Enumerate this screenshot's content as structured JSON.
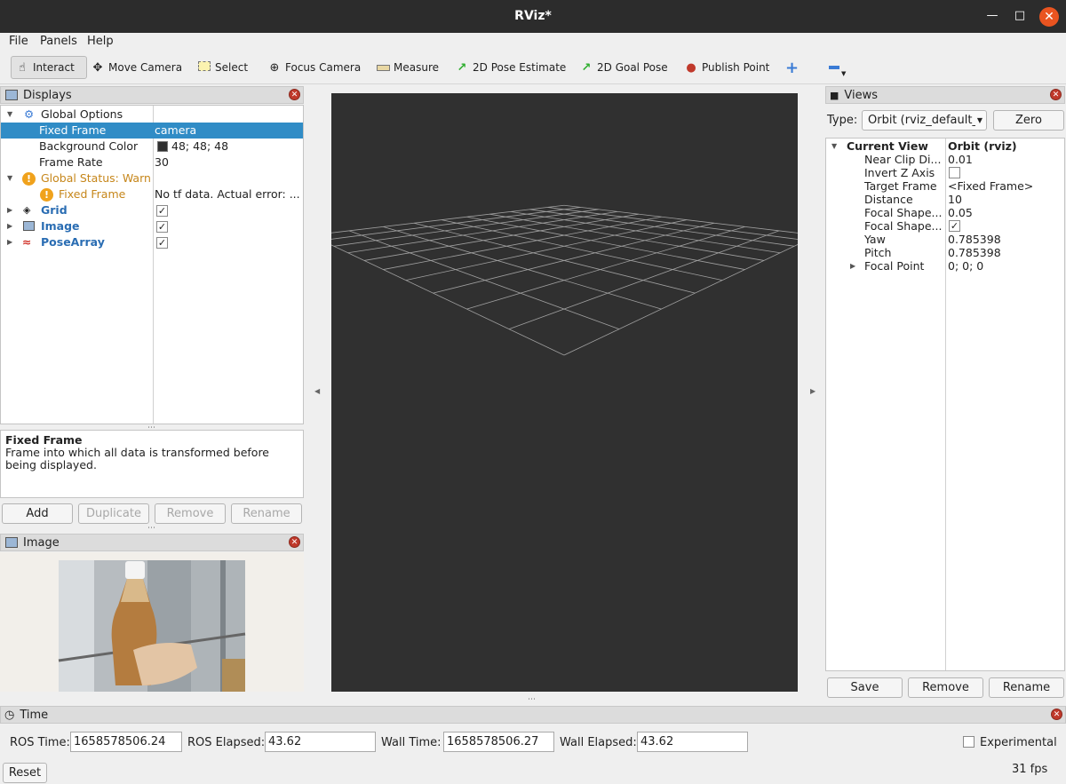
{
  "window": {
    "title": "RViz*"
  },
  "menu": {
    "file": "File",
    "panels": "Panels",
    "help": "Help"
  },
  "toolbar": {
    "interact": "Interact",
    "move_camera": "Move Camera",
    "select": "Select",
    "focus_camera": "Focus Camera",
    "measure": "Measure",
    "pose_estimate": "2D Pose Estimate",
    "goal_pose": "2D Goal Pose",
    "publish_point": "Publish Point"
  },
  "displays": {
    "title": "Displays",
    "rows": [
      {
        "key": "Global Options",
        "value": ""
      },
      {
        "key": "Fixed Frame",
        "value": "camera"
      },
      {
        "key": "Background Color",
        "value": "48; 48; 48"
      },
      {
        "key": "Frame Rate",
        "value": "30"
      },
      {
        "key": "Global Status: Warn",
        "value": ""
      },
      {
        "key": "Fixed Frame",
        "value": "No tf data.  Actual error: ..."
      },
      {
        "key": "Grid",
        "value": ""
      },
      {
        "key": "Image",
        "value": ""
      },
      {
        "key": "PoseArray",
        "value": ""
      }
    ],
    "description_title": "Fixed Frame",
    "description_text": "Frame into which all data is transformed before being displayed.",
    "buttons": {
      "add": "Add",
      "duplicate": "Duplicate",
      "remove": "Remove",
      "rename": "Rename"
    }
  },
  "image_panel": {
    "title": "Image"
  },
  "views": {
    "title": "Views",
    "type_label": "Type:",
    "type_value": "Orbit (rviz_default_",
    "zero": "Zero",
    "rows": [
      {
        "key": "Current View",
        "value": "Orbit (rviz)"
      },
      {
        "key": "Near Clip Di...",
        "value": "0.01"
      },
      {
        "key": "Invert Z Axis",
        "value": ""
      },
      {
        "key": "Target Frame",
        "value": "<Fixed Frame>"
      },
      {
        "key": "Distance",
        "value": "10"
      },
      {
        "key": "Focal Shape...",
        "value": "0.05"
      },
      {
        "key": "Focal Shape...",
        "value": ""
      },
      {
        "key": "Yaw",
        "value": "0.785398"
      },
      {
        "key": "Pitch",
        "value": "0.785398"
      },
      {
        "key": "Focal Point",
        "value": "0; 0; 0"
      }
    ],
    "buttons": {
      "save": "Save",
      "remove": "Remove",
      "rename": "Rename"
    }
  },
  "time": {
    "title": "Time",
    "ros_time_label": "ROS Time:",
    "ros_time": "1658578506.24",
    "ros_elapsed_label": "ROS Elapsed:",
    "ros_elapsed": "43.62",
    "wall_time_label": "Wall Time:",
    "wall_time": "1658578506.27",
    "wall_elapsed_label": "Wall Elapsed:",
    "wall_elapsed": "43.62",
    "experimental": "Experimental",
    "reset": "Reset",
    "fps": "31 fps"
  },
  "colors": {
    "selection": "#308cc6",
    "viewport_bg": "#303030",
    "warn": "#c6861a",
    "display_name": "#2a6db3"
  }
}
